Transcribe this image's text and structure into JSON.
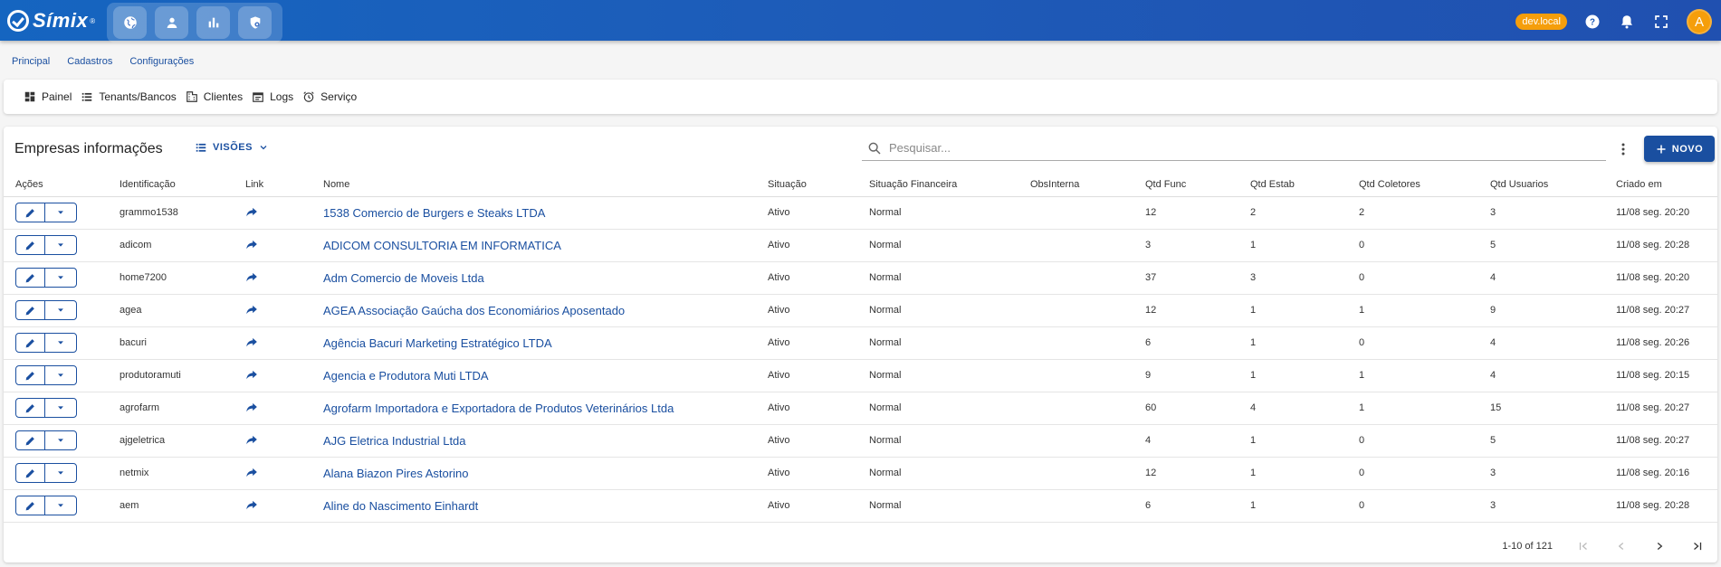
{
  "app": {
    "name": "Símix",
    "reg_mark": "®",
    "env_badge": "dev.local",
    "avatar_initial": "A",
    "modules": [
      "globe-icon",
      "person-icon",
      "bar-chart-icon",
      "shield-gear-icon"
    ],
    "colors": {
      "primary": "#1a4fa0",
      "topbar": "#1565c0",
      "badge": "#f59e0b"
    }
  },
  "menu": [
    "Principal",
    "Cadastros",
    "Configurações"
  ],
  "subnav": [
    {
      "icon": "dashboard-icon",
      "label": "Painel"
    },
    {
      "icon": "list-icon",
      "label": "Tenants/Bancos"
    },
    {
      "icon": "building-icon",
      "label": "Clientes"
    },
    {
      "icon": "calendar-icon",
      "label": "Logs"
    },
    {
      "icon": "alarm-icon",
      "label": "Serviço"
    }
  ],
  "card": {
    "title": "Empresas informações",
    "visoes_label": "VISÕES",
    "search_placeholder": "Pesquisar...",
    "novo_label": "NOVO"
  },
  "table": {
    "columns": [
      "Ações",
      "Identificação",
      "Link",
      "Nome",
      "Situação",
      "Situação Financeira",
      "ObsInterna",
      "Qtd Func",
      "Qtd Estab",
      "Qtd Coletores",
      "Qtd Usuarios",
      "Criado em"
    ],
    "rows": [
      {
        "id": "grammo1538",
        "nome": "1538 Comercio de Burgers e Steaks LTDA",
        "situacao": "Ativo",
        "financeira": "Normal",
        "obs": "",
        "func": "12",
        "estab": "2",
        "coletores": "2",
        "usuarios": "3",
        "criado": "11/08 seg. 20:20"
      },
      {
        "id": "adicom",
        "nome": "ADICOM CONSULTORIA EM INFORMATICA",
        "situacao": "Ativo",
        "financeira": "Normal",
        "obs": "",
        "func": "3",
        "estab": "1",
        "coletores": "0",
        "usuarios": "5",
        "criado": "11/08 seg. 20:28"
      },
      {
        "id": "home7200",
        "nome": "Adm Comercio de Moveis Ltda",
        "situacao": "Ativo",
        "financeira": "Normal",
        "obs": "",
        "func": "37",
        "estab": "3",
        "coletores": "0",
        "usuarios": "4",
        "criado": "11/08 seg. 20:20"
      },
      {
        "id": "agea",
        "nome": "AGEA Associação Gaúcha dos Economiários Aposentado",
        "situacao": "Ativo",
        "financeira": "Normal",
        "obs": "",
        "func": "12",
        "estab": "1",
        "coletores": "1",
        "usuarios": "9",
        "criado": "11/08 seg. 20:27"
      },
      {
        "id": "bacuri",
        "nome": "Agência Bacuri Marketing Estratégico LTDA",
        "situacao": "Ativo",
        "financeira": "Normal",
        "obs": "",
        "func": "6",
        "estab": "1",
        "coletores": "0",
        "usuarios": "4",
        "criado": "11/08 seg. 20:26"
      },
      {
        "id": "produtoramuti",
        "nome": "Agencia e Produtora Muti LTDA",
        "situacao": "Ativo",
        "financeira": "Normal",
        "obs": "",
        "func": "9",
        "estab": "1",
        "coletores": "1",
        "usuarios": "4",
        "criado": "11/08 seg. 20:15"
      },
      {
        "id": "agrofarm",
        "nome": "Agrofarm Importadora e Exportadora de Produtos Veterinários Ltda",
        "situacao": "Ativo",
        "financeira": "Normal",
        "obs": "",
        "func": "60",
        "estab": "4",
        "coletores": "1",
        "usuarios": "15",
        "criado": "11/08 seg. 20:27"
      },
      {
        "id": "ajgeletrica",
        "nome": "AJG Eletrica Industrial Ltda",
        "situacao": "Ativo",
        "financeira": "Normal",
        "obs": "",
        "func": "4",
        "estab": "1",
        "coletores": "0",
        "usuarios": "5",
        "criado": "11/08 seg. 20:27"
      },
      {
        "id": "netmix",
        "nome": "Alana Biazon Pires Astorino",
        "situacao": "Ativo",
        "financeira": "Normal",
        "obs": "",
        "func": "12",
        "estab": "1",
        "coletores": "0",
        "usuarios": "3",
        "criado": "11/08 seg. 20:16"
      },
      {
        "id": "aem",
        "nome": "Aline do Nascimento Einhardt",
        "situacao": "Ativo",
        "financeira": "Normal",
        "obs": "",
        "func": "6",
        "estab": "1",
        "coletores": "0",
        "usuarios": "3",
        "criado": "11/08 seg. 20:28"
      }
    ]
  },
  "pager": {
    "range": "1-10 of 121"
  }
}
